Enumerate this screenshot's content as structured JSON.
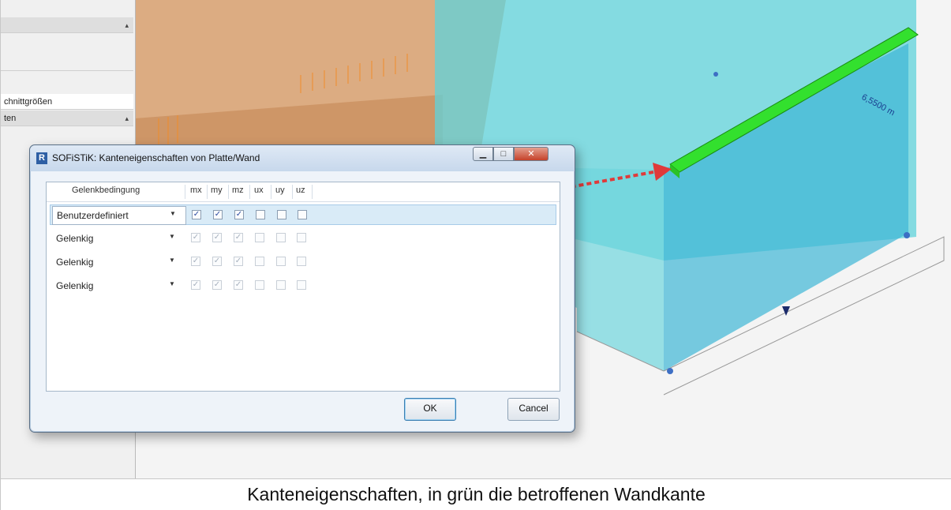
{
  "panel": {
    "rows": [
      "",
      "",
      "chnittgrößen",
      "ten"
    ]
  },
  "model": {
    "dimension_label": "6,5500 m"
  },
  "dialog": {
    "app_icon": "R",
    "title": "SOFiSTiK: Kanteneigenschaften von Platte/Wand",
    "headers": {
      "condition": "Gelenkbedingung",
      "mx": "mx",
      "my": "my",
      "mz": "mz",
      "ux": "ux",
      "uy": "uy",
      "uz": "uz"
    },
    "rows": [
      {
        "condition": "Benutzerdefiniert",
        "mx": true,
        "my": true,
        "mz": true,
        "ux": false,
        "uy": false,
        "uz": false
      },
      {
        "condition": "Gelenkig",
        "mx": true,
        "my": true,
        "mz": true,
        "ux": false,
        "uy": false,
        "uz": false
      },
      {
        "condition": "Gelenkig",
        "mx": true,
        "my": true,
        "mz": true,
        "ux": false,
        "uy": false,
        "uz": false
      },
      {
        "condition": "Gelenkig",
        "mx": true,
        "my": true,
        "mz": true,
        "ux": false,
        "uy": false,
        "uz": false
      }
    ],
    "ok_label": "OK",
    "cancel_label": "Cancel"
  },
  "caption": "Kanteneigenschaften, in grün die betroffenen Wandkante",
  "colors": {
    "wall": "#5fd3db",
    "slab": "#d9a476",
    "edge_highlight": "#33e02e",
    "arrow": "#e03a3a",
    "load": "#f08c2a"
  }
}
